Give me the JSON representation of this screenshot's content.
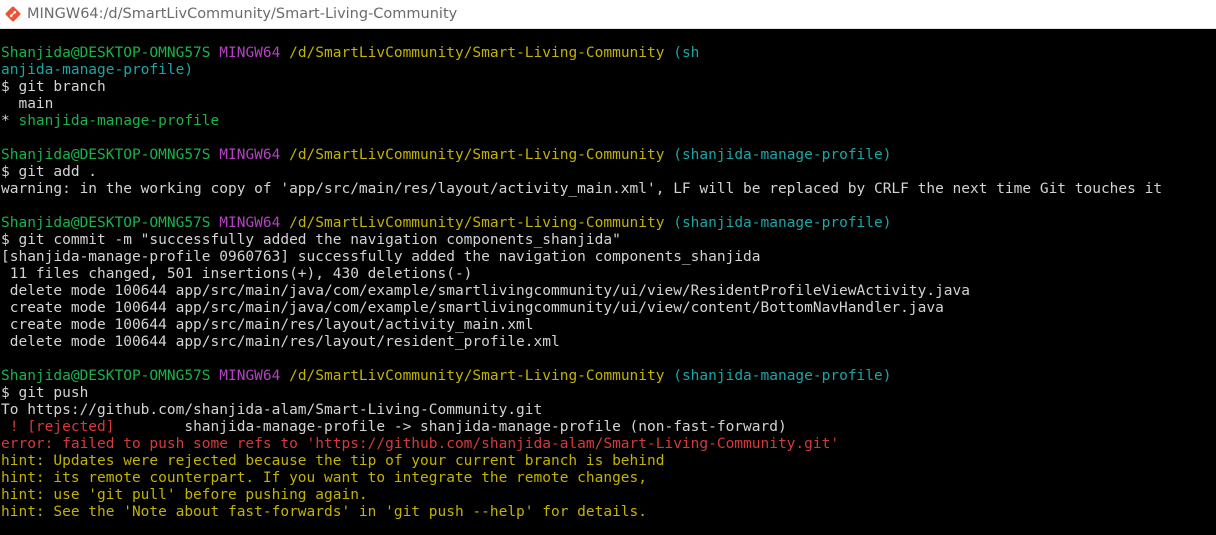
{
  "window": {
    "title": "MINGW64:/d/SmartLivCommunity/Smart-Living-Community",
    "icon": "git-bash-icon"
  },
  "colors": {
    "background": "#000000",
    "user_host": "#19b34a",
    "shell": "#b540c4",
    "path": "#c2b300",
    "branch": "#1aa6a6",
    "error": "#d53a3a",
    "text": "#d3d3d3"
  },
  "terminal": {
    "prompt1": {
      "user_host": "Shanjida@DESKTOP-OMNG57S",
      "shell": "MINGW64",
      "path": "/d/SmartLivCommunity/Smart-Living-Community",
      "branch_part1": "(sh",
      "branch_part2": "anjida-manage-profile)"
    },
    "cmd1": "$ git branch",
    "branch_main": "  main",
    "branch_current_marker": "* ",
    "branch_current": "shanjida-manage-profile",
    "prompt2": {
      "user_host": "Shanjida@DESKTOP-OMNG57S",
      "shell": "MINGW64",
      "path": "/d/SmartLivCommunity/Smart-Living-Community",
      "branch": "(shanjida-manage-profile)"
    },
    "cmd2": "$ git add .",
    "warning": "warning: in the working copy of 'app/src/main/res/layout/activity_main.xml', LF will be replaced by CRLF the next time Git touches it",
    "prompt3": {
      "user_host": "Shanjida@DESKTOP-OMNG57S",
      "shell": "MINGW64",
      "path": "/d/SmartLivCommunity/Smart-Living-Community",
      "branch": "(shanjida-manage-profile)"
    },
    "cmd3": "$ git commit -m \"successfully added the navigation components_shanjida\"",
    "commit_output": [
      "[shanjida-manage-profile 0960763] successfully added the navigation components_shanjida",
      " 11 files changed, 501 insertions(+), 430 deletions(-)",
      " delete mode 100644 app/src/main/java/com/example/smartlivingcommunity/ui/view/ResidentProfileViewActivity.java",
      " create mode 100644 app/src/main/java/com/example/smartlivingcommunity/ui/view/content/BottomNavHandler.java",
      " create mode 100644 app/src/main/res/layout/activity_main.xml",
      " delete mode 100644 app/src/main/res/layout/resident_profile.xml"
    ],
    "prompt4": {
      "user_host": "Shanjida@DESKTOP-OMNG57S",
      "shell": "MINGW64",
      "path": "/d/SmartLivCommunity/Smart-Living-Community",
      "branch": "(shanjida-manage-profile)"
    },
    "cmd4": "$ git push",
    "push_to": "To https://github.com/shanjida-alam/Smart-Living-Community.git",
    "rejected_tag": " ! [rejected]",
    "rejected_detail": "        shanjida-manage-profile -> shanjida-manage-profile (non-fast-forward)",
    "error_line": "error: failed to push some refs to 'https://github.com/shanjida-alam/Smart-Living-Community.git'",
    "hints": [
      "hint: Updates were rejected because the tip of your current branch is behind",
      "hint: its remote counterpart. If you want to integrate the remote changes,",
      "hint: use 'git pull' before pushing again.",
      "hint: See the 'Note about fast-forwards' in 'git push --help' for details."
    ]
  }
}
